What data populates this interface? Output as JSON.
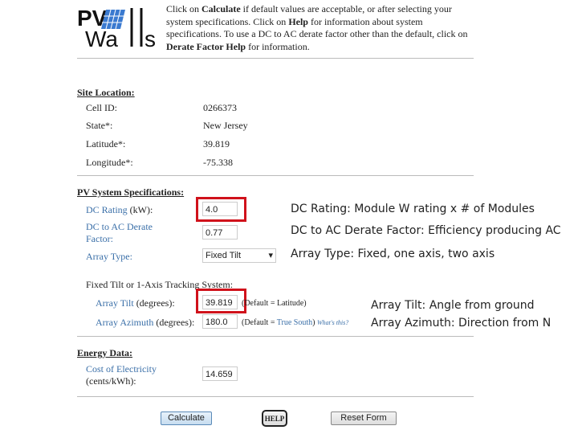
{
  "logo": {
    "text": "PV Watts"
  },
  "intro": {
    "p1": "Click on ",
    "b1": "Calculate",
    "p2": " if default values are acceptable, or after selecting your system specifications. Click on ",
    "b2": "Help",
    "p3": " for information about system specifications. To use a DC to AC derate factor other than the default, click on ",
    "b3": "Derate Factor Help",
    "p4": " for information."
  },
  "site": {
    "heading": "Site Location:",
    "rows": [
      {
        "label": "Cell ID:",
        "value": "0266373"
      },
      {
        "label": "State*:",
        "value": "New Jersey"
      },
      {
        "label": "Latitude*:",
        "value": "39.819"
      },
      {
        "label": "Longitude*:",
        "value": "-75.338"
      }
    ]
  },
  "pv": {
    "heading": "PV System Specifications:",
    "dc_rating_link": "DC Rating",
    "dc_rating_unit": " (kW):",
    "dc_rating": "4.0",
    "derate_link": "DC to AC Derate Factor:",
    "derate": "0.77",
    "array_type_link": "Array Type:",
    "array_type": "Fixed Tilt",
    "tracking_label": "Fixed Tilt or 1-Axis Tracking System:",
    "tilt_link": "Array Tilt",
    "tilt_unit": " (degrees):",
    "tilt": "39.819",
    "tilt_default": "(Default = Latitude)",
    "azimuth_link": "Array Azimuth",
    "azimuth_unit": " (degrees):",
    "azimuth": "180.0",
    "az_default_pre": "(Default = ",
    "az_default_link": "True South",
    "az_default_post": ")",
    "whats_this": "What's this?"
  },
  "energy": {
    "heading": "Energy Data:",
    "cost_link": "Cost of Electricity",
    "cost_unit": "(cents/kWh):",
    "cost": "14.659"
  },
  "buttons": {
    "calculate": "Calculate",
    "help": "HELP",
    "reset": "Reset Form"
  },
  "annotations": {
    "dc": "DC Rating: Module W rating x  # of Modules",
    "derate": "DC to AC Derate Factor: Efficiency producing AC",
    "type": "Array Type: Fixed, one axis, two axis",
    "tilt": "Array Tilt: Angle from ground",
    "azimuth": "Array Azimuth: Direction from N"
  },
  "colors": {
    "link": "#3a6fa8",
    "highlight": "#d0121b"
  }
}
